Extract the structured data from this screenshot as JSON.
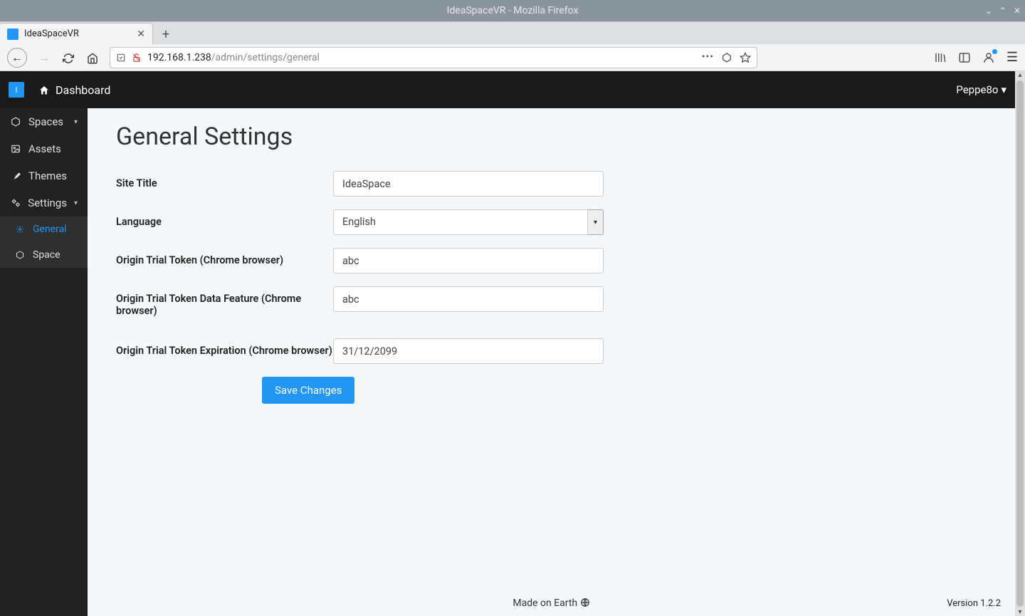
{
  "os": {
    "title": "IdeaSpaceVR - Mozilla Firefox"
  },
  "browser": {
    "tab_title": "IdeaSpaceVR",
    "url_host": "192.168.1.238",
    "url_path": "/admin/settings/general"
  },
  "navbar": {
    "dashboard_label": "Dashboard",
    "user_name": "Peppe8o"
  },
  "sidebar": {
    "items": [
      {
        "label": "Spaces",
        "icon": "cube",
        "caret": true
      },
      {
        "label": "Assets",
        "icon": "image",
        "caret": false
      },
      {
        "label": "Themes",
        "icon": "brush",
        "caret": false
      },
      {
        "label": "Settings",
        "icon": "cogs",
        "caret": true
      }
    ],
    "sub_items": [
      {
        "label": "General",
        "icon": "cog",
        "active": true
      },
      {
        "label": "Space",
        "icon": "cube",
        "active": false
      }
    ]
  },
  "page": {
    "title": "General Settings",
    "fields": {
      "site_title": {
        "label": "Site Title",
        "value": "IdeaSpace"
      },
      "language": {
        "label": "Language",
        "value": "English"
      },
      "token": {
        "label": "Origin Trial Token (Chrome browser)",
        "value": "abc"
      },
      "token_data": {
        "label": "Origin Trial Token Data Feature (Chrome browser)",
        "value": "abc"
      },
      "token_expiration": {
        "label": "Origin Trial Token Expiration (Chrome browser)",
        "value": "31/12/2099"
      }
    },
    "submit_label": "Save Changes"
  },
  "footer": {
    "text": "Made on Earth",
    "version": "Version 1.2.2"
  }
}
